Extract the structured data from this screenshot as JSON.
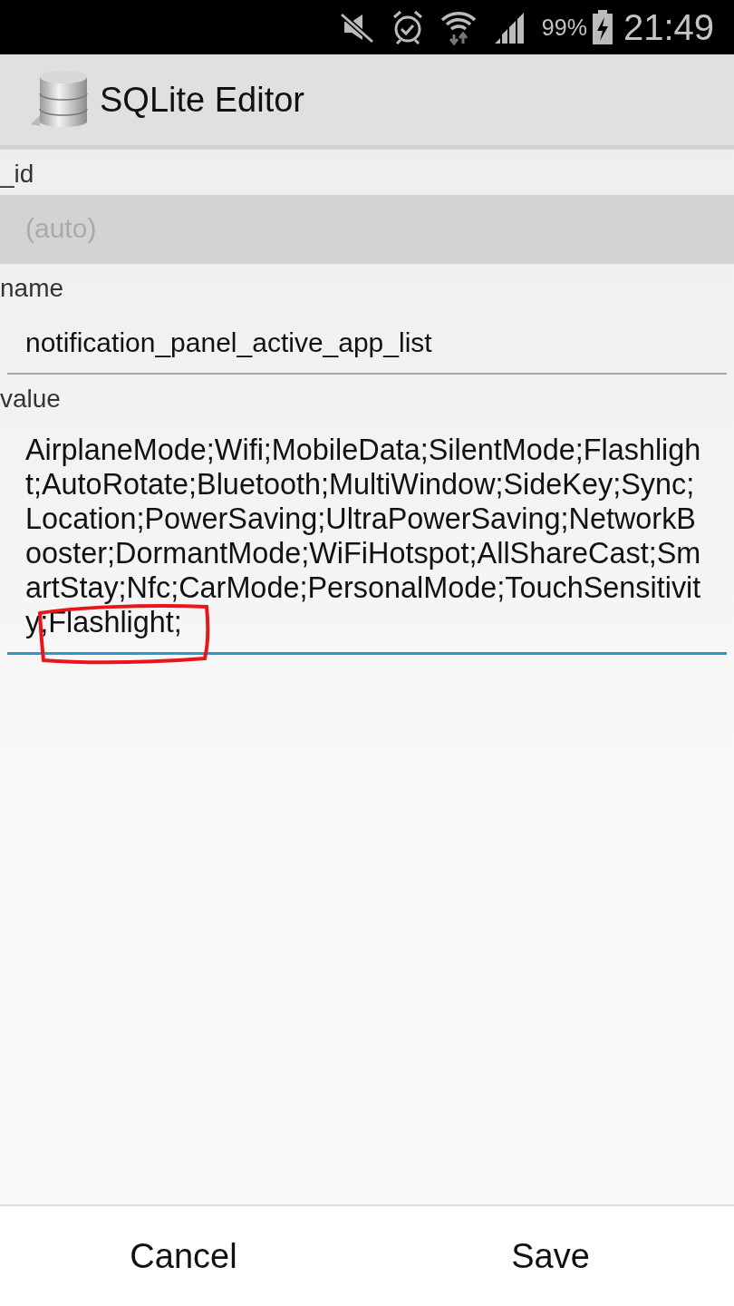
{
  "status_bar": {
    "battery": "99%",
    "time": "21:49"
  },
  "app_bar": {
    "title": "SQLite Editor"
  },
  "fields": [
    {
      "label": "_id",
      "placeholder": "(auto)",
      "disabled": true,
      "focused": false
    },
    {
      "label": "name",
      "value": "notification_panel_active_app_list",
      "disabled": false,
      "focused": false
    },
    {
      "label": "value",
      "value": "AirplaneMode;Wifi;MobileData;SilentMode;Flashlight;AutoRotate;Bluetooth;MultiWindow;SideKey;Sync;Location;PowerSaving;UltraPowerSaving;NetworkBooster;DormantMode;WiFiHotspot;AllShareCast;SmartStay;Nfc;CarMode;PersonalMode;TouchSensitivity;Flashlight;",
      "disabled": false,
      "focused": true
    }
  ],
  "annotations": [
    {
      "kind": "outline",
      "color": "#e8161b"
    }
  ],
  "buttons": [
    "Cancel",
    "Save"
  ]
}
